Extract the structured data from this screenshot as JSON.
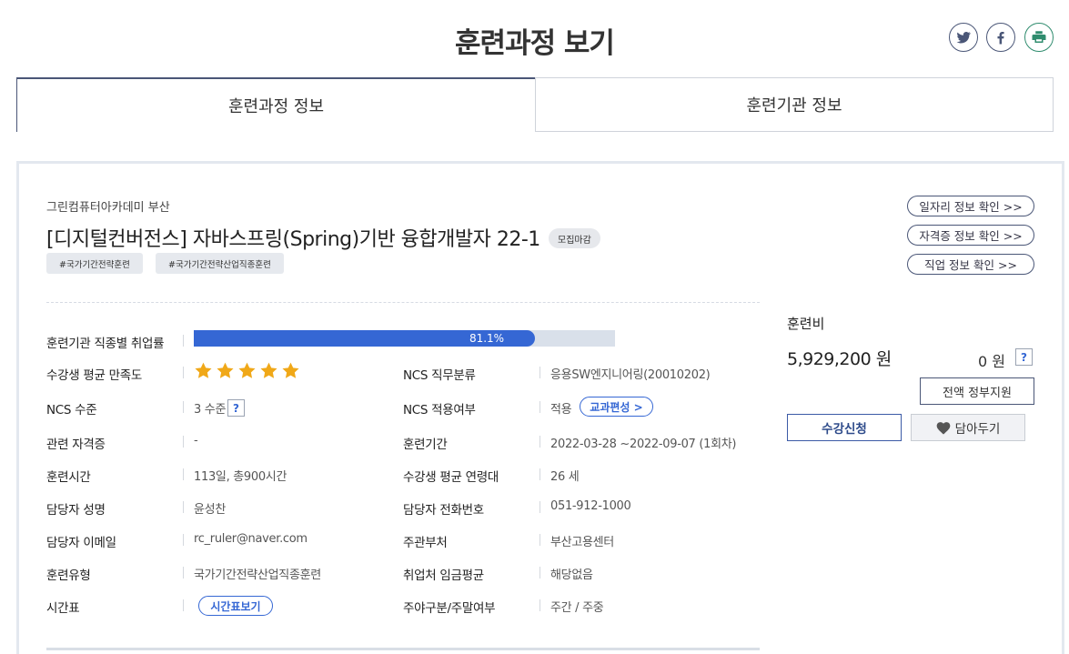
{
  "header": {
    "title": "훈련과정 보기",
    "share_icons": [
      "twitter-icon",
      "facebook-icon",
      "print-icon"
    ]
  },
  "tabs": [
    {
      "label": "훈련과정 정보",
      "active": true
    },
    {
      "label": "훈련기관 정보",
      "active": false
    }
  ],
  "course": {
    "institution": "그린컴퓨터아카데미 부산",
    "title": "[디지털컨버전스] 자바스프링(Spring)기반 융합개발자 22-1",
    "status_badge": "모집마감",
    "tags": [
      "#국가기간전략훈련",
      "#국가기간전략산업직종훈련"
    ]
  },
  "links": {
    "job_info": "일자리 정보 확인 >>",
    "cert_info": "자격증 정보 확인 >>",
    "occupation_info": "직업 정보 확인 >>"
  },
  "details": {
    "employment_rate_label": "훈련기관 직종별 취업률",
    "employment_rate_text": "81.1%",
    "employment_rate_value": 81.1,
    "satisfaction_label": "수강생 평균 만족도",
    "satisfaction_stars": 5,
    "ncs_job_label": "NCS 직무분류",
    "ncs_job_value": "응용SW엔지니어링(20010202)",
    "ncs_level_label": "NCS 수준",
    "ncs_level_value": "3 수준",
    "help_symbol": "?",
    "ncs_apply_label": "NCS 적용여부",
    "ncs_apply_value": "적용",
    "curriculum_button": "교과편성 >",
    "cert_label": "관련 자격증",
    "cert_value": "-",
    "period_label": "훈련기간",
    "period_value": "2022-03-28 ~2022-09-07 (1회차)",
    "hours_label": "훈련시간",
    "hours_value": "113일, 총900시간",
    "age_label": "수강생 평균 연령대",
    "age_value": "26 세",
    "manager_label": "담당자 성명",
    "manager_value": "윤성찬",
    "phone_label": "담당자 전화번호",
    "phone_value": "051-912-1000",
    "email_label": "담당자 이메일",
    "email_value": "rc_ruler@naver.com",
    "dept_label": "주관부처",
    "dept_value": "부산고용센터",
    "type_label": "훈련유형",
    "type_value": "국가기간전략산업직종훈련",
    "wage_label": "취업처 임금평균",
    "wage_value": "해당없음",
    "schedule_label": "시간표",
    "schedule_button": "시간표보기",
    "daynight_label": "주야구분/주말여부",
    "daynight_value": "주간 / 주중"
  },
  "fee": {
    "label": "훈련비",
    "amount": "5,929,200 원",
    "self_pay": "0 원",
    "gov_support_button": "전액 정부지원",
    "apply_button": "수강신청",
    "wishlist_button": "담아두기"
  },
  "colors": {
    "accent": "#3567d4",
    "navy": "#4a5677",
    "star": "#f0a818"
  }
}
